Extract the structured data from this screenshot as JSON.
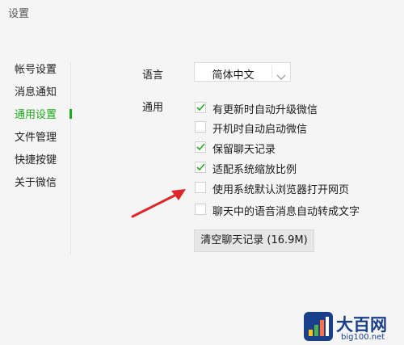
{
  "window": {
    "title": "设置"
  },
  "sidebar": {
    "items": [
      {
        "label": "帐号设置"
      },
      {
        "label": "消息通知"
      },
      {
        "label": "通用设置",
        "active": true
      },
      {
        "label": "文件管理"
      },
      {
        "label": "快捷按键"
      },
      {
        "label": "关于微信"
      }
    ]
  },
  "language": {
    "label": "语言",
    "value": "简体中文"
  },
  "general": {
    "label": "通用",
    "options": [
      {
        "label": "有更新时自动升级微信",
        "checked": true
      },
      {
        "label": "开机时自动启动微信",
        "checked": false
      },
      {
        "label": "保留聊天记录",
        "checked": true
      },
      {
        "label": "适配系统缩放比例",
        "checked": true
      },
      {
        "label": "使用系统默认浏览器打开网页",
        "checked": false
      },
      {
        "label": "聊天中的语音消息自动转成文字",
        "checked": false
      }
    ]
  },
  "clear_chat": {
    "label": "清空聊天记录 (16.9M)"
  },
  "colors": {
    "accent": "#1aad19",
    "arrow": "#e0262b",
    "watermark": "#1a3f8a"
  },
  "watermark": {
    "brand": "大百网",
    "url": "big100.net"
  }
}
